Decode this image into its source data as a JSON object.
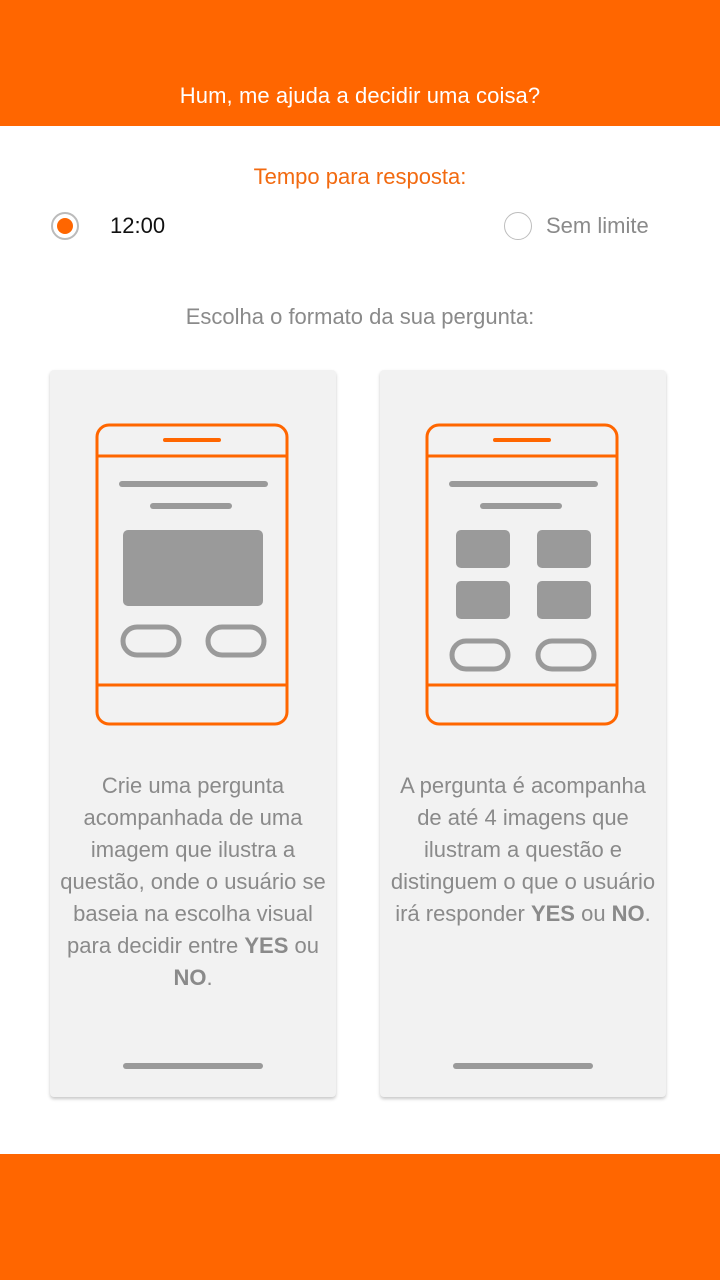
{
  "header": {
    "title": "Hum, me ajuda a decidir uma coisa?"
  },
  "time": {
    "label": "Tempo para resposta:",
    "options": [
      {
        "label": "12:00",
        "selected": true
      },
      {
        "label": "Sem limite",
        "selected": false
      }
    ]
  },
  "format": {
    "label": "Escolha o formato da sua pergunta:",
    "cards": [
      {
        "icon": "phone-single-image-icon",
        "desc_before": "Crie uma pergunta acompanhada de uma imagem que ilustra a questão, onde o usuário se baseia na escolha visual para decidir entre ",
        "yes": "YES",
        "ou": " ou ",
        "no": "NO",
        "end": "."
      },
      {
        "icon": "phone-four-images-icon",
        "desc_before": "A  pergunta é acompanha de até 4 imagens que ilustram a questão e distinguem o que o usuário irá responder ",
        "yes": "YES",
        "ou": " ou ",
        "no": "NO",
        "end": "."
      }
    ]
  },
  "colors": {
    "accent": "#ff6600",
    "text_gray": "#8a8a8a",
    "card_bg": "#f2f2f2"
  }
}
